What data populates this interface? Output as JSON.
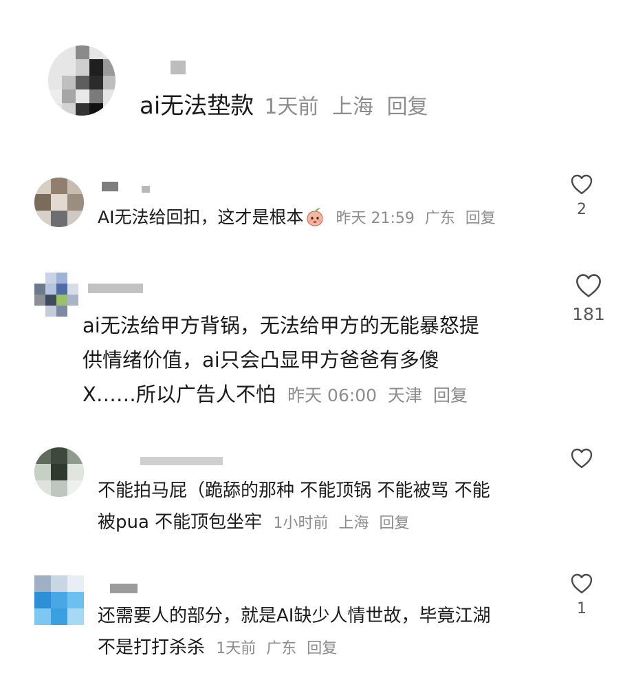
{
  "top_comment": {
    "text": "ai无法垫款",
    "time": "1天前",
    "location": "上海",
    "reply_label": "回复"
  },
  "replies": [
    {
      "text": "AI无法给回扣，这才是根本",
      "has_emoji": true,
      "time": "昨天 21:59",
      "location": "广东",
      "reply_label": "回复",
      "likes": "2"
    },
    {
      "lines": [
        "ai无法给甲方背锅，无法给甲方的无能暴怒提",
        "供情绪价值，ai只会凸显甲方爸爸有多傻",
        "X……所以广告人不怕"
      ],
      "time": "昨天 06:00",
      "location": "天津",
      "reply_label": "回复",
      "likes": "181"
    },
    {
      "lines": [
        "不能拍马屁（跪舔的那种 不能顶锅 不能被骂 不能",
        "被pua 不能顶包坐牢"
      ],
      "time": "1小时前",
      "location": "上海",
      "reply_label": "回复",
      "likes": ""
    },
    {
      "lines": [
        "还需要人的部分，就是AI缺少人情世故，毕竟江湖",
        "不是打打杀杀"
      ],
      "time": "1天前",
      "location": "广东",
      "reply_label": "回复",
      "likes": "1"
    }
  ],
  "colors": {
    "text": "#1a1a1a",
    "meta": "#8c8c8c",
    "like_icon": "#4a4a4a"
  },
  "icons": {
    "like": "heart-outline-icon",
    "emoji": "peach-face-emoji-icon"
  }
}
